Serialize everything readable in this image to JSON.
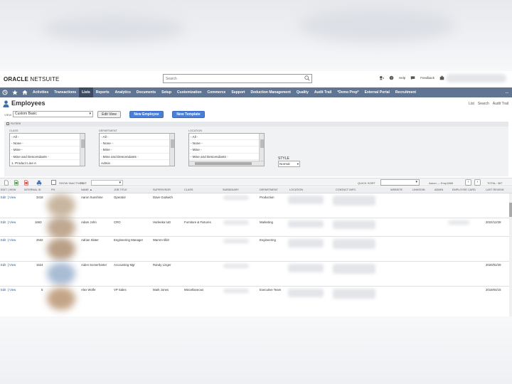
{
  "header": {
    "logo_brand": "ORACLE",
    "logo_product": "NETSUITE",
    "search_placeholder": "Search",
    "help_label": "Help",
    "feedback_label": "Feedback"
  },
  "nav": {
    "items": [
      "Activities",
      "Transactions",
      "Lists",
      "Reports",
      "Analytics",
      "Documents",
      "Setup",
      "Customization",
      "Commerce",
      "Support",
      "Deduction Management",
      "Quality",
      "Audit Trail",
      "*Demo Prep*",
      "External Portal",
      "Recruitment"
    ],
    "active": "Lists",
    "more": "..."
  },
  "page": {
    "title": "Employees",
    "links": [
      "List",
      "Search",
      "Audit Trail"
    ],
    "view_label": "VIEW",
    "view_value": "Custom Basic",
    "edit_view": "Edit View",
    "new_employee": "New Employee",
    "new_template": "New Template"
  },
  "filters": {
    "title": "FILTERS",
    "class": {
      "label": "CLASS",
      "options": [
        "- All -",
        "- None -",
        "- Mine -",
        "- Mine and Descendants -",
        "1. Product Line A"
      ]
    },
    "department": {
      "label": "DEPARTMENT",
      "options": [
        "- All -",
        "- None -",
        "- Mine -",
        "- Mine and Descendants -",
        "Admin"
      ]
    },
    "location": {
      "label": "LOCATION",
      "options": [
        "- All -",
        "- None -",
        "- Mine -",
        "- Mine and Descendants -"
      ]
    },
    "style": {
      "label": "STYLE",
      "value": "Normal"
    }
  },
  "toolbar": {
    "show_inactives": "SHOW INACTIVES",
    "edit_label": "EDIT",
    "quick_sort": "QUICK SORT",
    "range": "Aaron — Emp1865",
    "total": "TOTAL: 367"
  },
  "table": {
    "columns": [
      "EDIT | VIEW",
      "INTERNAL ID",
      "PH",
      "NAME ▲",
      "JOB TITLE",
      "SUPERVISOR",
      "CLASS",
      "SUBSIDIARY",
      "DEPARTMENT",
      "LOCATION",
      "CONTACT INFO",
      "WEBSITE",
      "LINKEDIN",
      "ADMIN",
      "EMPLOYEE CARD",
      "LAST REVIEW"
    ],
    "rows": [
      {
        "edit": "Edit",
        "view": "View",
        "id": "3418",
        "name": "Aaron Sunshine",
        "job": "Operator",
        "supervisor": "Dave Godwich",
        "class": "",
        "department": "Production",
        "last_review": ""
      },
      {
        "edit": "Edit",
        "view": "View",
        "id": "1663",
        "name": "Adam John",
        "job": "CRO",
        "supervisor": "Harleeka tutz",
        "class": "Furniture & Fixtures",
        "department": "Marketing",
        "last_review": "2022/12/28"
      },
      {
        "edit": "Edit",
        "view": "View",
        "id": "2532",
        "name": "Adrian Slater",
        "job": "Engineering Manager",
        "supervisor": "Warren tilldr",
        "class": "",
        "department": "Engineering",
        "last_review": ""
      },
      {
        "edit": "Edit",
        "view": "View",
        "id": "1524",
        "name": "Aiden Somerharter",
        "job": "Accounting Mgr",
        "supervisor": "Randy Linger",
        "class": "",
        "department": "",
        "last_review": "2020/02/29"
      },
      {
        "edit": "Edit",
        "view": "View",
        "id": "5",
        "name": "Alex Wolfe",
        "job": "VP Sales",
        "supervisor": "Mark Jones",
        "class": "Miscellaneous",
        "department": "Executive Team",
        "last_review": "2019/04/15"
      }
    ]
  },
  "colors": {
    "nav": "#5f7592",
    "nav_active": "#3b4b61",
    "button_blue": "#4a7fd6",
    "link": "#2b5f9e"
  }
}
